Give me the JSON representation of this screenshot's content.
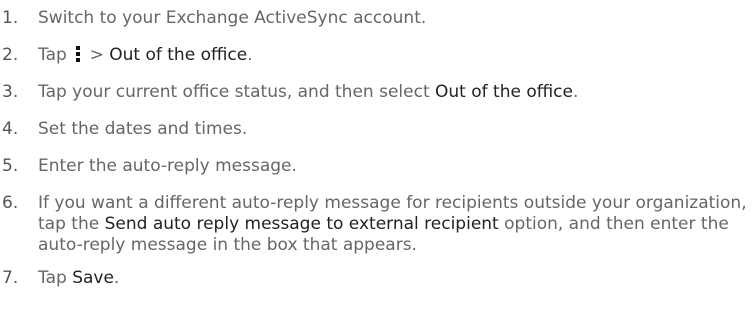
{
  "steps": [
    {
      "number": "1.",
      "text": "Switch to your Exchange ActiveSync account."
    },
    {
      "number": "2.",
      "prefix": "Tap",
      "separator": ">",
      "option": "Out of the office",
      "suffix": "."
    },
    {
      "number": "3.",
      "text_before": "Tap your current office status, and then select ",
      "option": "Out of the office",
      "suffix": "."
    },
    {
      "number": "4.",
      "text": "Set the dates and times."
    },
    {
      "number": "5.",
      "text": "Enter the auto-reply message."
    },
    {
      "number": "6.",
      "text_before": "If you want a different auto-reply message for recipients outside your organization, tap the ",
      "option": "Send auto reply message to external recipient",
      "text_after": " option, and then enter the auto-reply message in the box that appears."
    },
    {
      "number": "7.",
      "prefix": "Tap ",
      "option": "Save",
      "suffix": "."
    }
  ],
  "icons": {
    "menu": "more-vertical-icon"
  }
}
